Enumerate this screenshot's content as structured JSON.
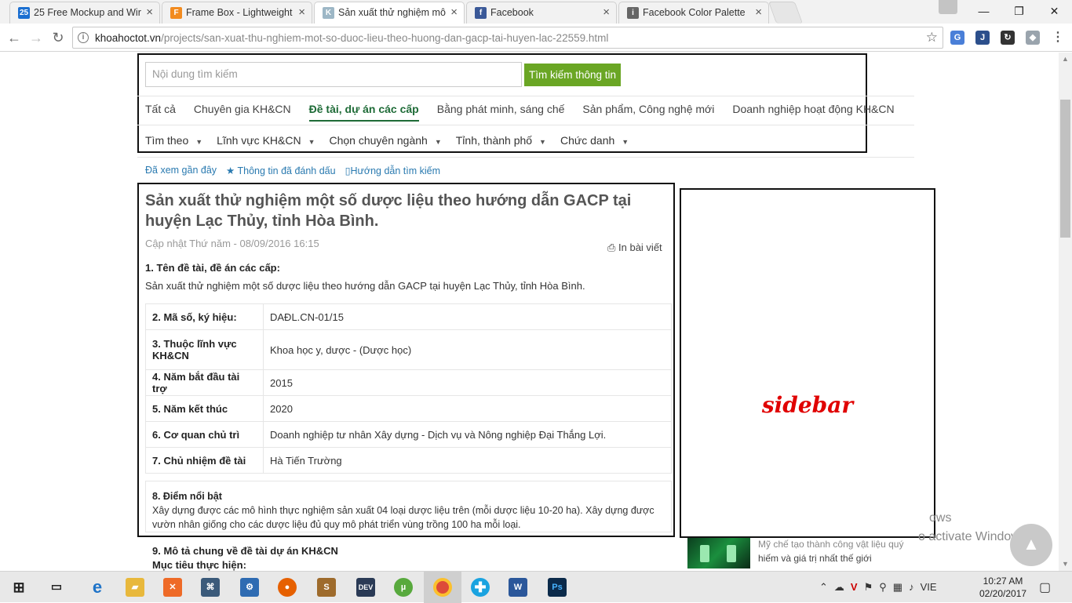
{
  "browser": {
    "tabs": [
      {
        "title": "25 Free Mockup and Wir",
        "favicon": "25",
        "color": "#1b6fd1"
      },
      {
        "title": "Frame Box - Lightweight",
        "favicon": "F",
        "color": "#f28b1f"
      },
      {
        "title": "Sản xuất thử nghiệm mô",
        "favicon": "K",
        "color": "#9db7c6"
      },
      {
        "title": "Facebook",
        "favicon": "f",
        "color": "#3b5998"
      },
      {
        "title": "Facebook Color Palette",
        "favicon": "i",
        "color": "#666666"
      }
    ],
    "active_tab": 2,
    "address": {
      "domain": "khoahoctot.vn",
      "path": "/projects/san-xuat-thu-nghiem-mot-so-duoc-lieu-theo-huong-dan-gacp-tai-huyen-lac-22559.html"
    }
  },
  "search": {
    "placeholder": "Nội dung tìm kiếm",
    "button_label": "Tìm kiếm thông tin"
  },
  "categories": [
    "Tất cả",
    "Chuyên gia KH&CN",
    "Đề tài, dự án các cấp",
    "Bằng phát minh, sáng chế",
    "Sản phẩm, Công nghệ mới",
    "Doanh nghiệp hoạt động KH&CN"
  ],
  "active_category": 2,
  "filters": [
    "Tìm theo",
    "Lĩnh vực KH&CN",
    "Chọn chuyên ngành",
    "Tỉnh, thành phố",
    "Chức danh"
  ],
  "quick_links": [
    "Đã xem gần đây",
    "Thông tin đã đánh dấu",
    "Hướng dẫn tìm kiếm"
  ],
  "article": {
    "title": "Sản xuất thử nghiệm một số dược liệu theo hướng dẫn GACP tại huyện Lạc Thủy, tỉnh Hòa Bình.",
    "date": "Cập nhật Thứ năm - 08/09/2016 16:15",
    "print_label": "In bài viết",
    "name_label": "1. Tên đề tài, đề án các cấp:",
    "name_value": "Sản xuất thử nghiệm một số dược liệu theo hướng dẫn GACP tại huyện Lạc Thủy, tỉnh Hòa Bình.",
    "rows": [
      {
        "label": "2. Mã số, ký hiệu:",
        "value": "DAĐL.CN-01/15"
      },
      {
        "label": "3. Thuộc lĩnh vực KH&CN",
        "value": "Khoa học y, dược - (Dược học)"
      },
      {
        "label": "4. Năm bắt đầu tài trợ",
        "value": "2015"
      },
      {
        "label": "5. Năm kết thúc",
        "value": "2020"
      },
      {
        "label": "6. Cơ quan chủ trì",
        "value": "Doanh nghiệp tư nhân Xây dựng - Dịch vụ và Nông nghiệp Đại Thắng Lợi."
      },
      {
        "label": "7. Chủ nhiệm đề tài",
        "value": "Hà Tiến Trường"
      }
    ],
    "highlight_label": "8. Điểm nổi bật",
    "highlight_text": "Xây dựng được các mô hình thực nghiệm sản xuất 04 loại dược liệu trên (mỗi dược liệu 10-20 ha). Xây dựng được vườn nhân giống cho các dược liệu đủ quy mô phát triển vùng trồng 100 ha mỗi loại.",
    "summary_label": "9. Mô tả chung về đề tài dự án KH&CN",
    "summary_sub": "Mục tiêu thực hiện:"
  },
  "sidebar": {
    "label": "sidebar"
  },
  "news": {
    "line1": "Mỹ chế tạo thành công vật liệu quý",
    "line2": "hiếm và giá trị nhất thế giới"
  },
  "watermark": {
    "line1": "ows",
    "line2": "o activate Window"
  },
  "taskbar": {
    "language": "VIE",
    "time": "10:27 AM",
    "date": "02/20/2017"
  }
}
